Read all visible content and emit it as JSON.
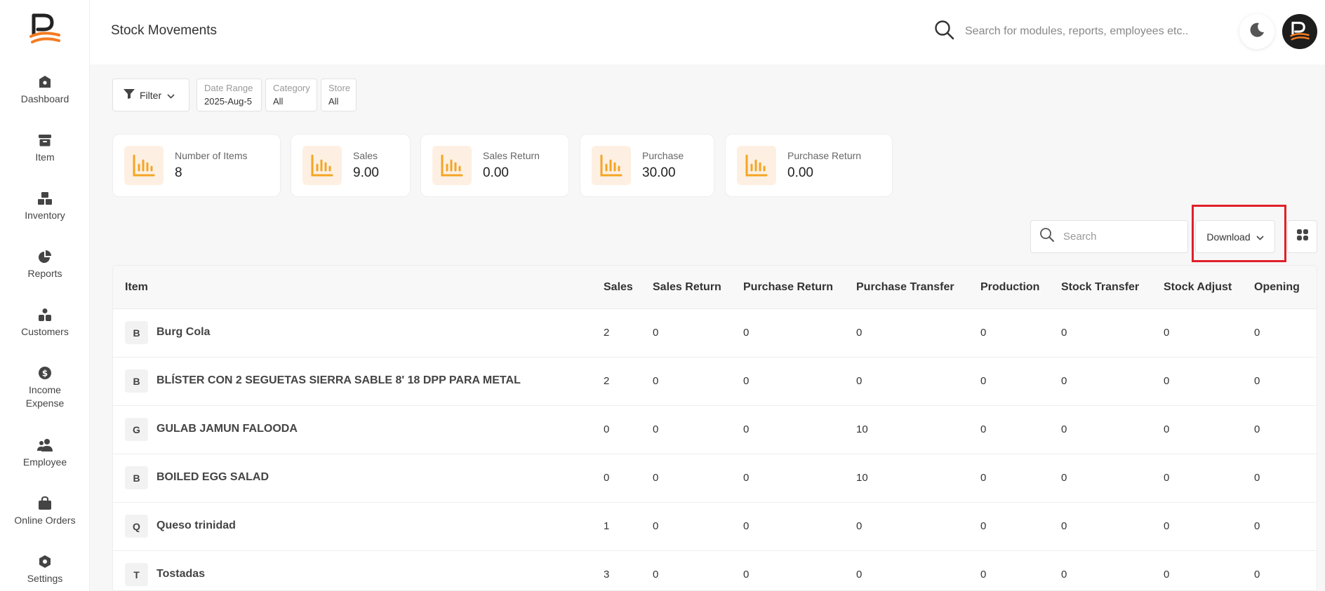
{
  "app": {
    "brand_color": "#f47b20"
  },
  "sidebar": {
    "items": [
      {
        "icon": "home-icon",
        "label": "Dashboard"
      },
      {
        "icon": "archive-icon",
        "label": "Item"
      },
      {
        "icon": "boxes-icon",
        "label": "Inventory"
      },
      {
        "icon": "pie-chart-icon",
        "label": "Reports"
      },
      {
        "icon": "customers-icon",
        "label": "Customers"
      },
      {
        "icon": "dollar-icon",
        "label": "Income\nExpense"
      },
      {
        "icon": "users-icon",
        "label": "Employee"
      },
      {
        "icon": "shopping-bag-icon",
        "label": "Online Orders"
      },
      {
        "icon": "gear-icon",
        "label": "Settings"
      }
    ]
  },
  "header": {
    "title": "Stock Movements",
    "search_placeholder": "Search for modules, reports, employees etc.."
  },
  "filters": {
    "filter_label": "Filter",
    "chips": [
      {
        "key": "Date Range",
        "value": "2025-Aug-5"
      },
      {
        "key": "Category",
        "value": "All"
      },
      {
        "key": "Store",
        "value": "All"
      }
    ]
  },
  "stats": [
    {
      "label": "Number of Items",
      "value": "8"
    },
    {
      "label": "Sales",
      "value": "9.00"
    },
    {
      "label": "Sales Return",
      "value": "0.00"
    },
    {
      "label": "Purchase",
      "value": "30.00"
    },
    {
      "label": "Purchase Return",
      "value": "0.00"
    }
  ],
  "toolbar": {
    "search_placeholder": "Search",
    "download_label": "Download"
  },
  "table": {
    "columns": [
      "Item",
      "Sales",
      "Sales Return",
      "Purchase Return",
      "Purchase Transfer",
      "Production",
      "Stock Transfer",
      "Stock Adjust",
      "Opening"
    ],
    "rows": [
      {
        "initial": "B",
        "item": "Burg Cola",
        "values": [
          "2",
          "0",
          "0",
          "0",
          "0",
          "0",
          "0",
          "0"
        ]
      },
      {
        "initial": "B",
        "item": "BLÍSTER CON 2 SEGUETAS SIERRA SABLE 8' 18 DPP PARA METAL",
        "values": [
          "2",
          "0",
          "0",
          "0",
          "0",
          "0",
          "0",
          "0"
        ]
      },
      {
        "initial": "G",
        "item": "GULAB JAMUN FALOODA",
        "values": [
          "0",
          "0",
          "0",
          "10",
          "0",
          "0",
          "0",
          "0"
        ]
      },
      {
        "initial": "B",
        "item": "BOILED EGG SALAD",
        "values": [
          "0",
          "0",
          "0",
          "10",
          "0",
          "0",
          "0",
          "0"
        ]
      },
      {
        "initial": "Q",
        "item": "Queso trinidad",
        "values": [
          "1",
          "0",
          "0",
          "0",
          "0",
          "0",
          "0",
          "0"
        ]
      },
      {
        "initial": "T",
        "item": "Tostadas",
        "values": [
          "3",
          "0",
          "0",
          "0",
          "0",
          "0",
          "0",
          "0"
        ]
      }
    ]
  }
}
